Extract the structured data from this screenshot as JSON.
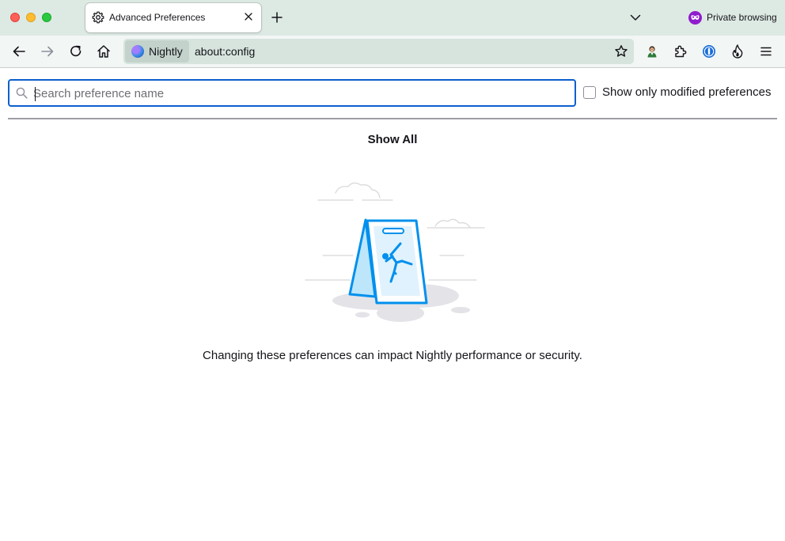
{
  "window": {
    "traffic_lights": [
      "close",
      "minimize",
      "maximize"
    ]
  },
  "tab": {
    "title": "Advanced Preferences",
    "icon": "gear-icon"
  },
  "private_browsing": {
    "label": "Private browsing",
    "color": "#8f1ccd"
  },
  "urlbar": {
    "identity_label": "Nightly",
    "url": "about:config"
  },
  "toolbar_icons": [
    "back-icon",
    "forward-icon",
    "reload-icon",
    "home-icon",
    "bookmark-star-icon",
    "account-avatar-icon",
    "extensions-icon",
    "password-manager-icon",
    "fire-icon",
    "menu-icon"
  ],
  "page": {
    "search_placeholder": "Search preference name",
    "search_value": "",
    "modified_only_label": "Show only modified preferences",
    "modified_only_checked": false,
    "show_all_label": "Show All",
    "warning_text": "Changing these preferences can impact Nightly performance or security."
  },
  "colors": {
    "focus_ring": "#0b5fcf",
    "tabstrip_bg": "#dde9e3",
    "illustration_blue": "#0090ed"
  }
}
